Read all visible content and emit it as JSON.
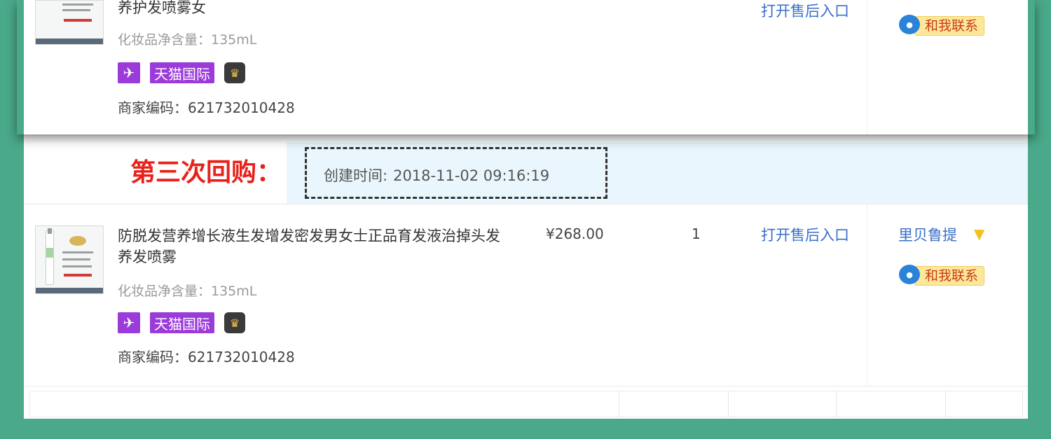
{
  "top_item": {
    "title_tail": "养护发喷雾女",
    "spec": "化妆品净含量：135mL",
    "badges": {
      "plane_icon": "airplane-icon",
      "tmall": "天猫国际",
      "crown_icon": "crown-icon"
    },
    "merchant_code": "商家编码：621732010428",
    "after_sale": "打开售后入口",
    "contact_label": "和我联系"
  },
  "repurchase": {
    "label": "第三次回购：",
    "created_label": "创建时间:",
    "created_time": "2018-11-02 09:16:19"
  },
  "item": {
    "title": "防脱发营养增长液生发增发密发男女士正品育发液治掉头发养发喷雾",
    "spec": "化妆品净含量：135mL",
    "badges": {
      "plane_icon": "airplane-icon",
      "tmall": "天猫国际",
      "crown_icon": "crown-icon"
    },
    "merchant_code": "商家编码：621732010428",
    "price": "¥268.00",
    "quantity": "1",
    "after_sale": "打开售后入口",
    "seller": "里贝鲁提",
    "seller_icon": "filter-icon",
    "contact_label": "和我联系"
  },
  "colors": {
    "background": "#4aa98a",
    "link": "#3a6fc8",
    "repurchase_label": "#e8221b",
    "badge_purple": "#9b3bd9",
    "highlight_row": "#e9f6fd"
  }
}
